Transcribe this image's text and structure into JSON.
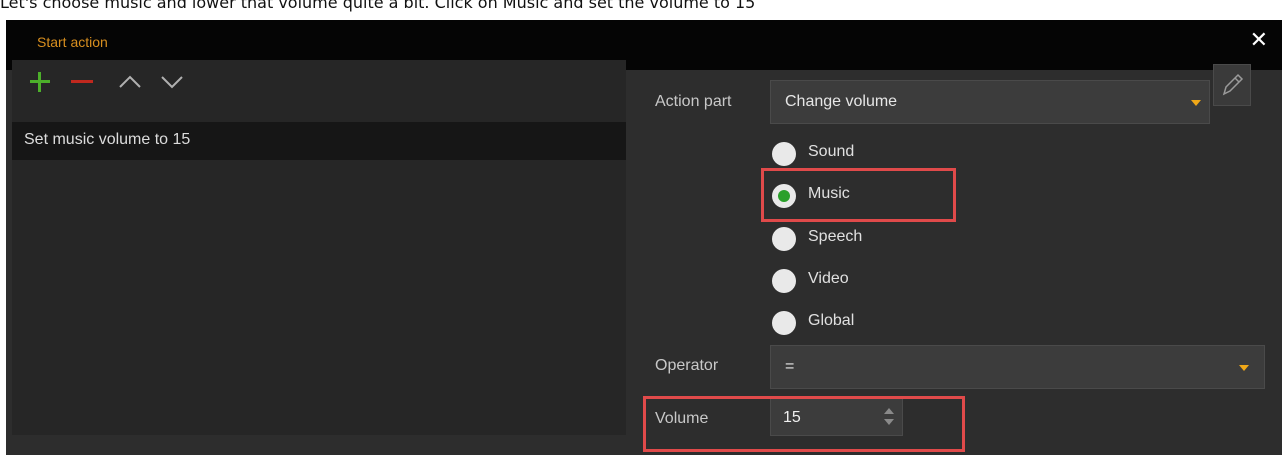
{
  "instruction": "Let's choose music and lower that volume quite a bit. Click on Music and set the volume to 15",
  "dialog": {
    "title": "Start action",
    "close_icon": "close-icon"
  },
  "toolbar": {
    "add_icon": "plus-icon",
    "remove_icon": "minus-icon",
    "up_icon": "chevron-up-icon",
    "down_icon": "chevron-down-icon"
  },
  "action_list": {
    "items": [
      {
        "label": "Set music volume to 15"
      }
    ]
  },
  "form": {
    "action_part_label": "Action part",
    "action_part_value": "Change volume",
    "edit_icon": "pencil-icon",
    "radio_options": [
      {
        "label": "Sound",
        "selected": false
      },
      {
        "label": "Music",
        "selected": true
      },
      {
        "label": "Speech",
        "selected": false
      },
      {
        "label": "Video",
        "selected": false
      },
      {
        "label": "Global",
        "selected": false
      }
    ],
    "operator_label": "Operator",
    "operator_value": "=",
    "volume_label": "Volume",
    "volume_value": "15"
  },
  "colors": {
    "title": "#d88f1f",
    "add": "#4caf2a",
    "remove": "#c0281e",
    "radio_selected": "#2aa02a",
    "highlight": "#e04a4a",
    "dropdown_arrow": "#f0a818"
  }
}
